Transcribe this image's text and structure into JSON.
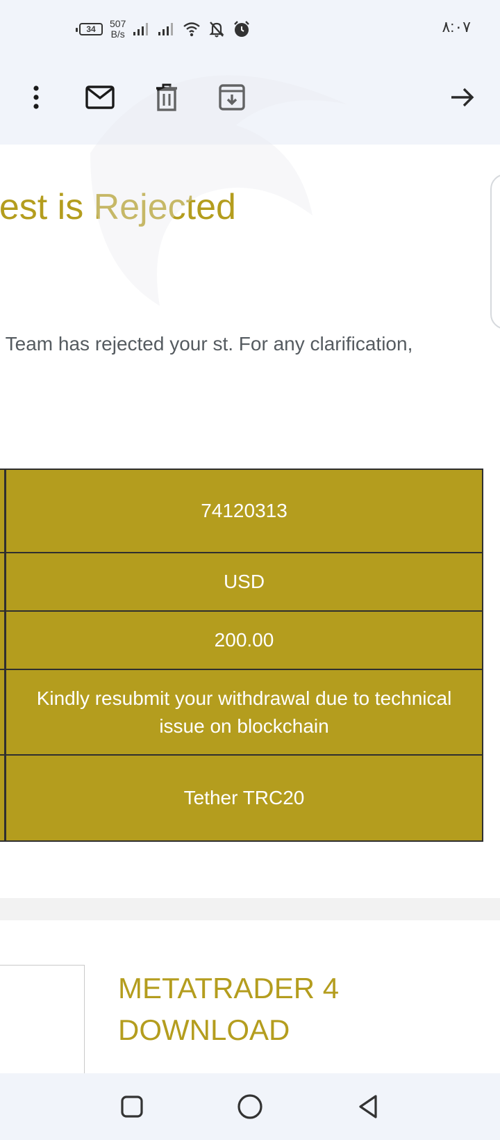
{
  "status_bar": {
    "battery": "34",
    "net_speed_value": "507",
    "net_speed_unit": "B/s",
    "time": "٨:٠٧"
  },
  "toolbar": {
    "icons": [
      "more-vert-icon",
      "mark-unread-icon",
      "delete-icon",
      "archive-icon",
      "arrow-forward-icon"
    ]
  },
  "email": {
    "title": "ndrawal Request is Rejected\nt",
    "body": "d, Our Internal Accounts Team has rejected your st. For any clarification, please feel free to",
    "rows": [
      {
        "value": "74120313"
      },
      {
        "value": "USD"
      },
      {
        "value": "200.00"
      },
      {
        "value": "Kindly resubmit your withdrawal due to technical issue on blockchain"
      },
      {
        "value": "Tether TRC20"
      }
    ],
    "mt4_link": "METATRADER 4 DOWNLOAD"
  },
  "nav": {
    "icons": [
      "recents-icon",
      "home-icon",
      "back-icon"
    ]
  },
  "colors": {
    "accent": "#b49d1e",
    "body_text": "#555b60",
    "bars": "#f1f4fa",
    "table_border": "#2f2f2f"
  }
}
